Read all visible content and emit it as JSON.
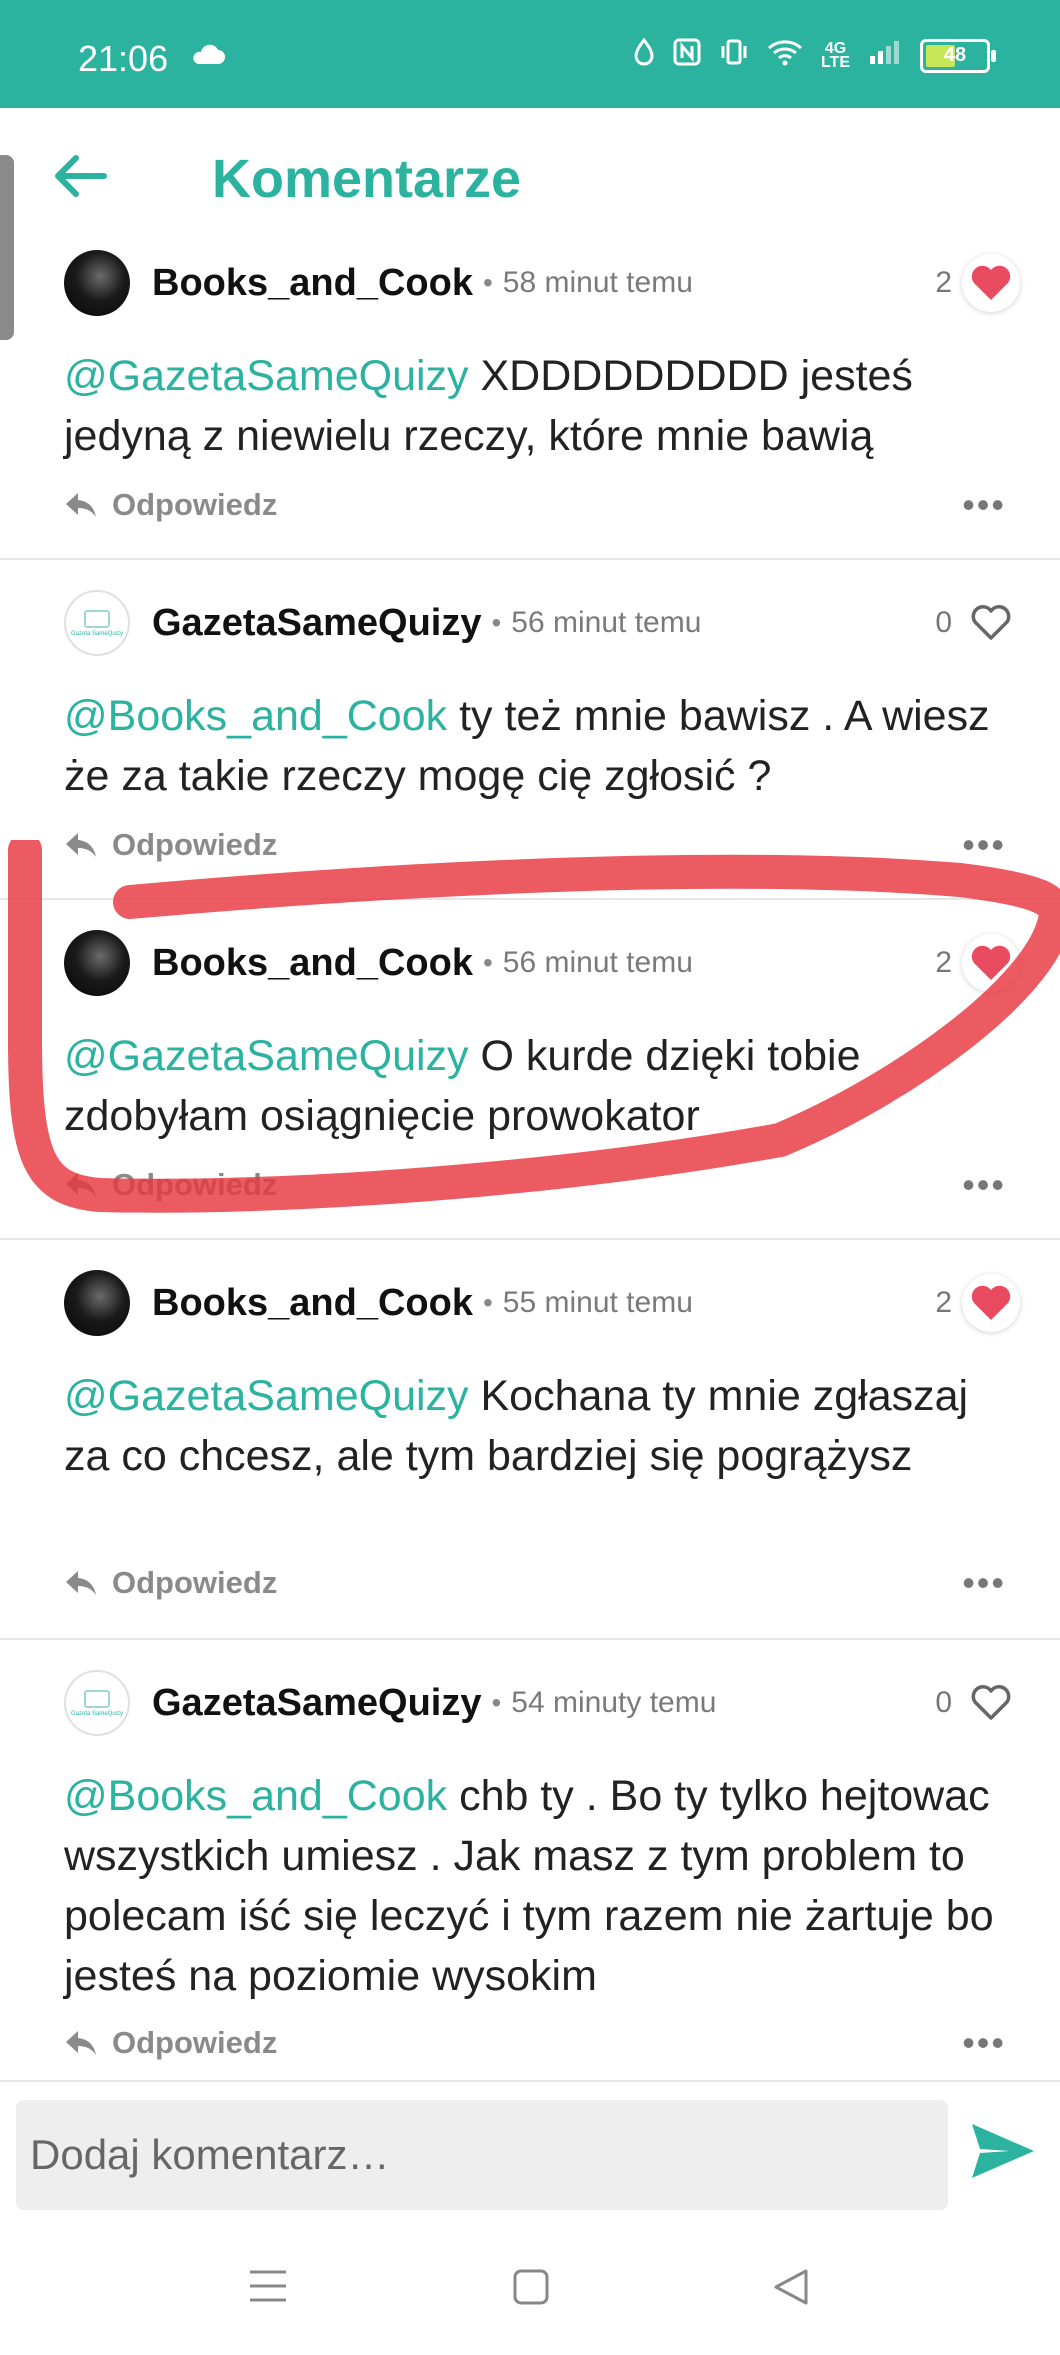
{
  "status_bar": {
    "time": "21:06",
    "battery": "48",
    "network": "4G",
    "volte": "LTE",
    "icons": [
      "cloud-icon",
      "data-saver-icon",
      "nfc-icon",
      "vibrate-icon",
      "wifi-icon",
      "signal-icon",
      "battery-icon"
    ]
  },
  "header": {
    "title": "Komentarze"
  },
  "comments": [
    {
      "author": "Books_and_Cook",
      "time": "58 minut temu",
      "likes": "2",
      "liked": true,
      "mention": "@GazetaSameQuizy",
      "text": " XDDDDDDDDD jesteś jedyną z niewielu rzeczy, które mnie bawią",
      "reply": "Odpowiedz",
      "more": "•••"
    },
    {
      "author": "GazetaSameQuizy",
      "time": "56 minut temu",
      "likes": "0",
      "liked": false,
      "mention": "@Books_and_Cook",
      "text": " ty też mnie bawisz . A wiesz że za takie rzeczy mogę cię zgłosić ?",
      "reply": "Odpowiedz",
      "more": "•••"
    },
    {
      "author": "Books_and_Cook",
      "time": "56 minut temu",
      "likes": "2",
      "liked": true,
      "mention": "@GazetaSameQuizy",
      "text": " O kurde dzięki tobie zdobyłam osiągnięcie prowokator",
      "reply": "Odpowiedz",
      "more": "•••"
    },
    {
      "author": "Books_and_Cook",
      "time": "55 minut temu",
      "likes": "2",
      "liked": true,
      "mention": "@GazetaSameQuizy",
      "text": " Kochana ty mnie zgłaszaj za co chcesz, ale tym bardziej się pogrążysz",
      "reply": "Odpowiedz",
      "more": "•••"
    },
    {
      "author": "GazetaSameQuizy",
      "time": "54 minuty temu",
      "likes": "0",
      "liked": false,
      "mention": "@Books_and_Cook",
      "text": " chb ty . Bo ty tylko hejtowac wszystkich umiesz . Jak masz z tym problem to polecam iść się leczyć i tym razem nie żartuje bo jesteś na poziomie wysokim",
      "reply": "Odpowiedz",
      "more": "•••"
    }
  ],
  "input": {
    "placeholder": "Dodaj komentarz…"
  },
  "colors": {
    "accent": "#2bb3a0",
    "heart": "#e84a5f",
    "annotation": "#e8373f"
  }
}
